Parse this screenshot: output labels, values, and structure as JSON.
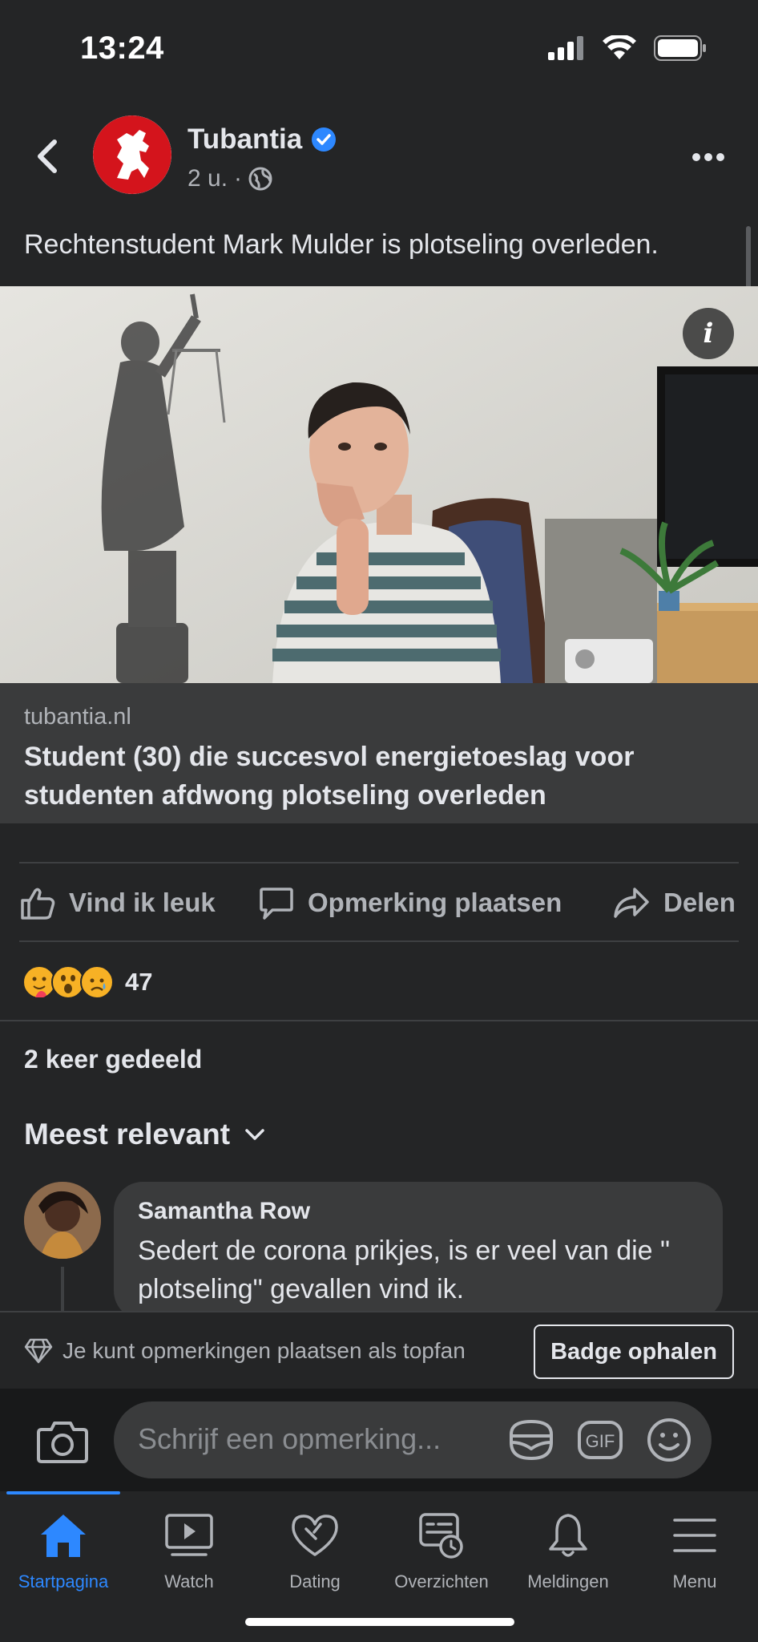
{
  "status_bar": {
    "time": "13:24"
  },
  "post": {
    "page_name": "Tubantia",
    "time_ago": "2 u.",
    "meta_separator": "·",
    "text": "Rechtenstudent Mark Mulder is plotseling overleden.",
    "link": {
      "domain": "tubantia.nl",
      "title": "Student (30) die succesvol energietoeslag voor studenten afdwong plotseling overleden"
    },
    "actions": {
      "like": "Vind ik leuk",
      "comment": "Opmerking plaatsen",
      "share": "Delen"
    },
    "reaction_count": "47",
    "reaction_icons": [
      "care-emoji",
      "wow-emoji",
      "sad-emoji"
    ],
    "shares": "2 keer gedeeld"
  },
  "comments": {
    "sort_label": "Meest relevant",
    "items": [
      {
        "author": "Samantha Row",
        "text": "Sedert de corona prikjes, is er veel van die \" plotseling\" gevallen vind ik."
      }
    ]
  },
  "topfan": {
    "text": "Je kunt opmerkingen plaatsen als topfan",
    "button": "Badge ophalen"
  },
  "composer": {
    "placeholder": "Schrijf een opmerking...",
    "gif_label": "GIF"
  },
  "nav": {
    "items": [
      {
        "label": "Startpagina",
        "icon": "home-icon",
        "active": true
      },
      {
        "label": "Watch",
        "icon": "watch-icon",
        "active": false
      },
      {
        "label": "Dating",
        "icon": "dating-icon",
        "active": false
      },
      {
        "label": "Overzichten",
        "icon": "feeds-icon",
        "active": false
      },
      {
        "label": "Meldingen",
        "icon": "bell-icon",
        "active": false
      },
      {
        "label": "Menu",
        "icon": "menu-icon",
        "active": false
      }
    ]
  },
  "colors": {
    "background": "#242526",
    "accent": "#2d88ff",
    "verified": "#2d88ff",
    "brand_red": "#d4141c"
  }
}
